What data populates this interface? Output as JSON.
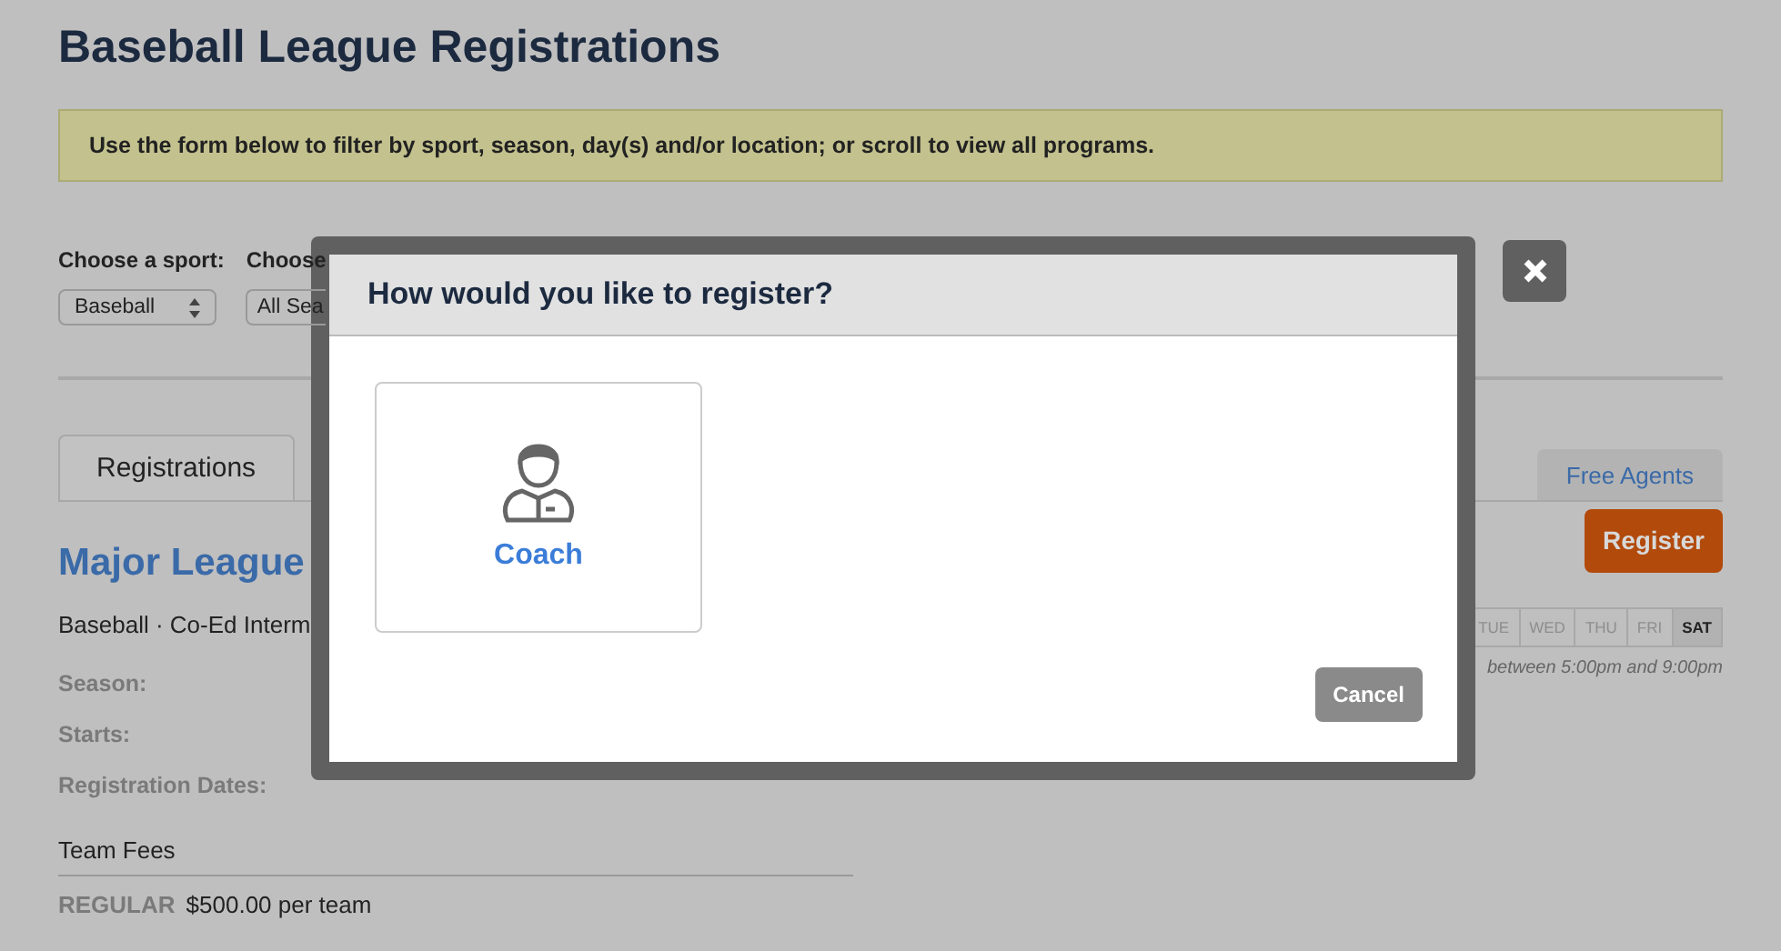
{
  "page": {
    "title": "Baseball League Registrations",
    "notice": "Use the form below to filter by sport, season, day(s) and/or location; or scroll to view all programs."
  },
  "filters": [
    {
      "label": "Choose a sport:",
      "value": "Baseball"
    },
    {
      "label": "Choose",
      "value": "All Sea"
    }
  ],
  "tabs": [
    {
      "label": "Registrations",
      "selected": true
    },
    {
      "label": "Free Agents",
      "selected": false
    }
  ],
  "program": {
    "title": "Major League",
    "subtitle": "Baseball · Co-Ed Interm",
    "register": "Register",
    "details": [
      "Season:",
      "Starts:",
      "Registration Dates:"
    ],
    "days": [
      {
        "label": "TUE",
        "selected": false
      },
      {
        "label": "WED",
        "selected": false
      },
      {
        "label": "THU",
        "selected": false
      },
      {
        "label": "FRI",
        "selected": false
      },
      {
        "label": "SAT",
        "selected": true
      }
    ],
    "time": "between 5:00pm and 9:00pm",
    "fees_title": "Team Fees",
    "fees": [
      {
        "type": "REGULAR",
        "amount": "$500.00 per team"
      }
    ]
  },
  "modal": {
    "title": "How would you like to register?",
    "options": [
      {
        "label": "Coach"
      }
    ],
    "cancel": "Cancel"
  }
}
